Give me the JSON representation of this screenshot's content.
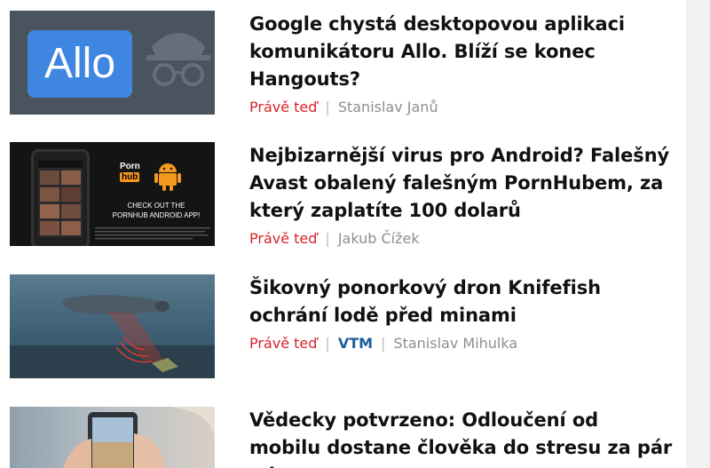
{
  "articles": [
    {
      "title": "Google chystá desktopovou aplikaci komunikátoru Allo. Blíží se konec Hangouts?",
      "time": "Právě teď",
      "category": "",
      "author": "Stanislav Janů",
      "thumb": {
        "logo_text": "Allo"
      }
    },
    {
      "title": "Nejbizarnější virus pro Android? Falešný Avast obalený falešným PornHubem, za který zaplatíte 100 dolarů",
      "time": "Právě teď",
      "category": "",
      "author": "Jakub Čížek",
      "thumb": {
        "brand_top": "Porn",
        "brand_bottom": "hub",
        "cta_line1": "CHECK OUT THE",
        "cta_line2": "PORNHUB ANDROID APP!"
      }
    },
    {
      "title": "Šikovný ponorkový dron Knifefish ochrání lodě před minami",
      "time": "Právě teď",
      "category": "VTM",
      "author": "Stanislav Mihulka",
      "thumb": {}
    },
    {
      "title": "Vědecky potvrzeno: Odloučení od mobilu dostane člověka do stresu za pár minut",
      "time": "",
      "category": "",
      "author": "",
      "thumb": {}
    }
  ],
  "colors": {
    "time": "#d8232a",
    "category": "#1b5e9e",
    "author": "#8e8e8e",
    "allo_blue": "#3f86e0",
    "pornhub_orange": "#f7971d",
    "android_orange": "#f29a1f"
  },
  "icons": [
    "incognito-icon",
    "android-icon"
  ]
}
